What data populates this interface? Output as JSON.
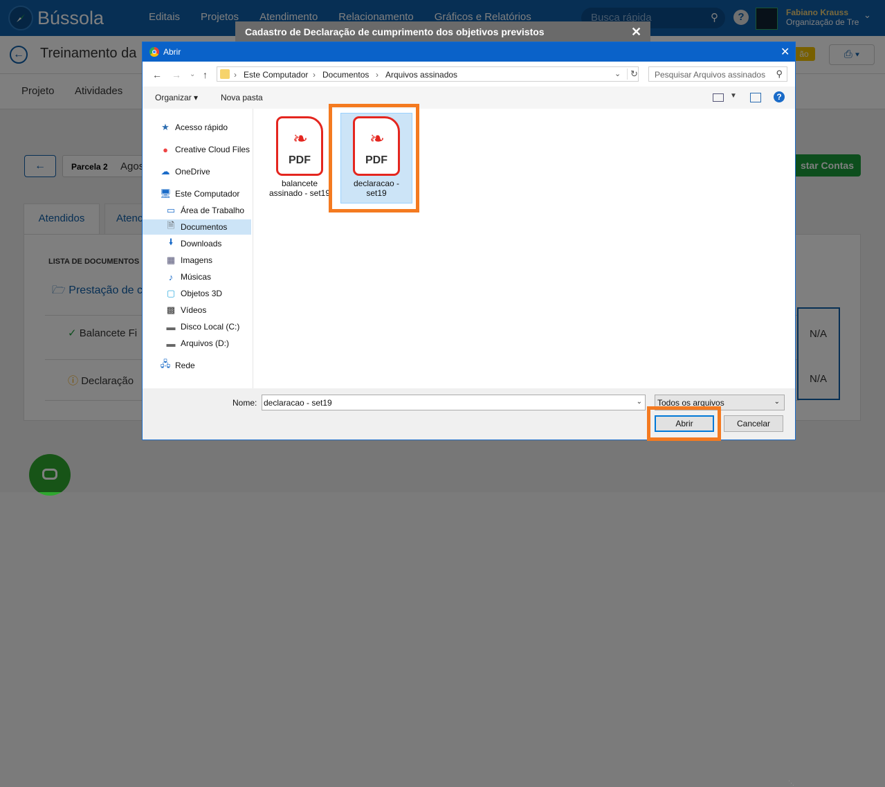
{
  "app": {
    "logo_text": "Bússola",
    "nav": [
      "Editais",
      "Projetos",
      "Atendimento",
      "Relacionamento",
      "Gráficos e Relatórios"
    ],
    "search_placeholder": "Busca rápida",
    "user_name": "Fabiano Krauss",
    "user_org": "Organização de Tre",
    "page_title": "Treinamento da",
    "status_badge": "ão",
    "tabs": [
      "Projeto",
      "Atividades"
    ],
    "parcela_label": "Parcela 2",
    "parcela_value": "Agos",
    "green_button": "star Contas",
    "content_tabs": [
      "Atendidos",
      "Atenc"
    ],
    "list_title": "LISTA DE DOCUMENTOS",
    "folder_label": "Prestação de c",
    "rows": [
      {
        "label": "Balancete Fi",
        "status": "N/A"
      },
      {
        "label": "Declaração",
        "status": "N/A"
      }
    ]
  },
  "modal": {
    "title": "Cadastro de Declaração de cumprimento dos objetivos previstos",
    "close": "✕"
  },
  "dialog": {
    "title": "Abrir",
    "close": "✕",
    "breadcrumb": [
      "Este Computador",
      "Documentos",
      "Arquivos assinados"
    ],
    "search_placeholder": "Pesquisar Arquivos assinados",
    "organize": "Organizar ▾",
    "new_folder": "Nova pasta",
    "sidebar": [
      {
        "label": "Acesso rápido",
        "icon": "star-icon"
      },
      {
        "label": "Creative Cloud Files",
        "icon": "creative-cloud-icon"
      },
      {
        "label": "OneDrive",
        "icon": "cloud-icon"
      },
      {
        "label": "Este Computador",
        "icon": "computer-icon"
      },
      {
        "label": "Área de Trabalho",
        "icon": "desktop-icon"
      },
      {
        "label": "Documentos",
        "icon": "document-icon"
      },
      {
        "label": "Downloads",
        "icon": "download-icon"
      },
      {
        "label": "Imagens",
        "icon": "image-icon"
      },
      {
        "label": "Músicas",
        "icon": "music-icon"
      },
      {
        "label": "Objetos 3D",
        "icon": "cube-icon"
      },
      {
        "label": "Vídeos",
        "icon": "video-icon"
      },
      {
        "label": "Disco Local (C:)",
        "icon": "drive-icon"
      },
      {
        "label": "Arquivos (D:)",
        "icon": "drive-icon"
      },
      {
        "label": "Rede",
        "icon": "network-icon"
      }
    ],
    "files": [
      {
        "name_line1": "balancete",
        "name_line2": "assinado - set19",
        "type": "PDF"
      },
      {
        "name_line1": "declaracao -",
        "name_line2": "set19",
        "type": "PDF"
      }
    ],
    "name_label": "Nome:",
    "name_value": "declaracao - set19",
    "filter_value": "Todos os arquivos",
    "open_button": "Abrir",
    "cancel_button": "Cancelar"
  }
}
